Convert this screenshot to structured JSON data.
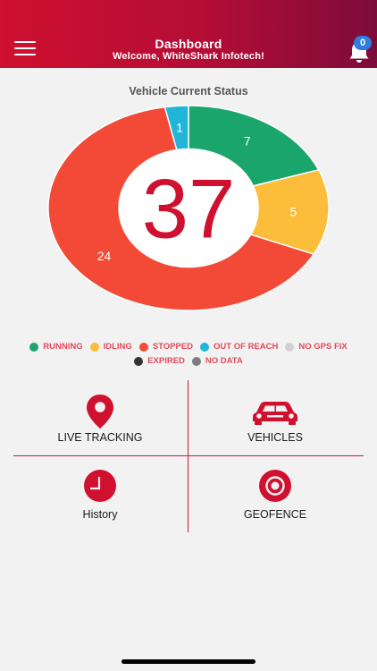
{
  "header": {
    "title": "Dashboard",
    "subtitle": "Welcome, WhiteShark Infotech!",
    "notification_count": "0",
    "gradient_colors": [
      "#cf1030",
      "#7d0c3a"
    ]
  },
  "status_chart": {
    "title": "Vehicle Current Status",
    "total": "37"
  },
  "chart_data": {
    "type": "pie",
    "title": "Vehicle Current Status",
    "center_label": "37",
    "slices": [
      {
        "label": "RUNNING",
        "value": 7,
        "color": "#1aa56d"
      },
      {
        "label": "IDLING",
        "value": 5,
        "color": "#fbbd3a"
      },
      {
        "label": "STOPPED",
        "value": 24,
        "color": "#f24a36"
      },
      {
        "label": "OUT OF REACH",
        "value": 1,
        "color": "#21b5d8"
      },
      {
        "label": "NO GPS FIX",
        "value": 0,
        "color": "#d2d2d2"
      },
      {
        "label": "EXPIRED",
        "value": 0,
        "color": "#333333"
      },
      {
        "label": "NO DATA",
        "value": 0,
        "color": "#7d7d7d"
      }
    ]
  },
  "legend": {
    "row1": [
      {
        "label": "RUNNING",
        "color": "#1aa56d"
      },
      {
        "label": "IDLING",
        "color": "#fbbd3a"
      },
      {
        "label": "STOPPED",
        "color": "#f24a36"
      },
      {
        "label": "OUT OF REACH",
        "color": "#21b5d8"
      },
      {
        "label": "NO GPS FIX",
        "color": "#d2d2d2"
      }
    ],
    "row2": [
      {
        "label": "EXPIRED",
        "color": "#333333"
      },
      {
        "label": "NO DATA",
        "color": "#7d7d7d"
      }
    ]
  },
  "menu": {
    "live_tracking": "LIVE TRACKING",
    "vehicles": "VEHICLES",
    "history": "History",
    "geofence": "GEOFENCE"
  },
  "colors": {
    "accent": "#d0102f",
    "divider": "#c81a3b"
  },
  "icons": {
    "menu": "hamburger-icon",
    "notifications": "bell-icon",
    "live_tracking": "map-pin-icon",
    "vehicles": "car-icon",
    "history": "clock-icon",
    "geofence": "target-icon"
  }
}
